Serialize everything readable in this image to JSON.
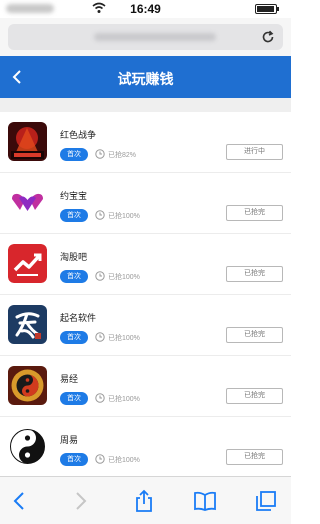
{
  "status": {
    "time": "16:49"
  },
  "header": {
    "title": "试玩赚钱"
  },
  "apps": [
    {
      "name": "红色战争",
      "badge": "首次",
      "progress": "已抢82%",
      "action": "进行中",
      "icon": "red-war-icon"
    },
    {
      "name": "约宝宝",
      "badge": "首次",
      "progress": "已抢100%",
      "action": "已抢完",
      "icon": "hearts-icon"
    },
    {
      "name": "淘股吧",
      "badge": "首次",
      "progress": "已抢100%",
      "action": "已抢完",
      "icon": "stock-chart-icon"
    },
    {
      "name": "起名软件",
      "badge": "首次",
      "progress": "已抢100%",
      "action": "已抢完",
      "icon": "calligraphy-icon"
    },
    {
      "name": "易经",
      "badge": "首次",
      "progress": "已抢100%",
      "action": "已抢完",
      "icon": "taiji-icon"
    },
    {
      "name": "周易",
      "badge": "首次",
      "progress": "已抢100%",
      "action": "已抢完",
      "icon": "yin-yang-icon"
    }
  ],
  "colors": {
    "accent": "#1f6fd1",
    "badge": "#1e7be6"
  }
}
